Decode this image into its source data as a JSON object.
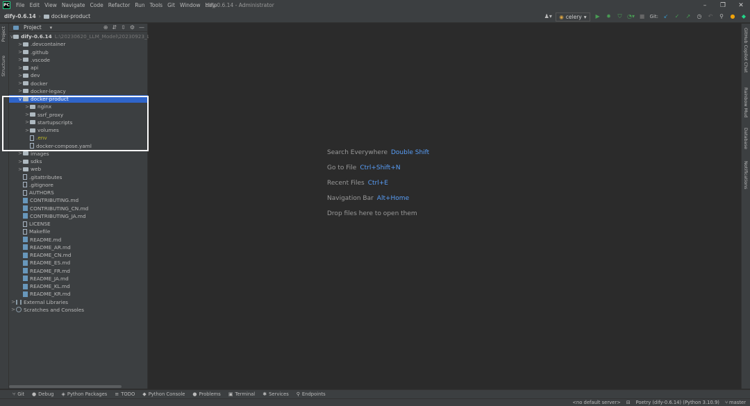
{
  "titlebar": {
    "app_logo": "PC",
    "menu": [
      "File",
      "Edit",
      "View",
      "Navigate",
      "Code",
      "Refactor",
      "Run",
      "Tools",
      "Git",
      "Window",
      "Help"
    ],
    "window_title": "dify-0.6.14 - Administrator",
    "controls": {
      "minimize": "–",
      "restore": "❐",
      "close": "✕"
    }
  },
  "navbar": {
    "project": "dify-0.6.14",
    "folder": "docker-product",
    "run_config": "celery",
    "git_label": "Git:"
  },
  "left_strip": {
    "tabs": [
      "Project",
      "Structure"
    ]
  },
  "right_strip": {
    "tabs": [
      "GitHub Copilot Chat",
      "Rainbow Mud",
      "Database",
      "Notifications"
    ]
  },
  "project_panel": {
    "title": "Project",
    "root": {
      "name": "dify-0.6.14",
      "path": "L:\\20230620_LLM_Model\\20230923_LLMO..."
    },
    "items": [
      {
        "label": ".devcontainer",
        "type": "folder",
        "depth": 1,
        "chevron": ">"
      },
      {
        "label": ".github",
        "type": "folder",
        "depth": 1,
        "chevron": ">"
      },
      {
        "label": ".vscode",
        "type": "folder",
        "depth": 1,
        "chevron": ">"
      },
      {
        "label": "api",
        "type": "folder",
        "depth": 1,
        "chevron": ">"
      },
      {
        "label": "dev",
        "type": "folder",
        "depth": 1,
        "chevron": ">"
      },
      {
        "label": "docker",
        "type": "folder",
        "depth": 1,
        "chevron": ">"
      },
      {
        "label": "docker-legacy",
        "type": "folder",
        "depth": 1,
        "chevron": ">"
      },
      {
        "label": "docker-product",
        "type": "folder",
        "depth": 1,
        "chevron": "v",
        "selected": true
      },
      {
        "label": "nginx",
        "type": "folder",
        "depth": 2,
        "chevron": ">"
      },
      {
        "label": "ssrf_proxy",
        "type": "folder",
        "depth": 2,
        "chevron": ">"
      },
      {
        "label": "startupscripts",
        "type": "folder",
        "depth": 2,
        "chevron": ">"
      },
      {
        "label": "volumes",
        "type": "folder",
        "depth": 2,
        "chevron": ">"
      },
      {
        "label": ".env",
        "type": "env",
        "depth": 2,
        "chevron": ""
      },
      {
        "label": "docker-compose.yaml",
        "type": "file",
        "depth": 2,
        "chevron": ""
      },
      {
        "label": "images",
        "type": "folder",
        "depth": 1,
        "chevron": ">"
      },
      {
        "label": "sdks",
        "type": "folder",
        "depth": 1,
        "chevron": ">"
      },
      {
        "label": "web",
        "type": "folder",
        "depth": 1,
        "chevron": ">"
      },
      {
        "label": ".gitattributes",
        "type": "file",
        "depth": 1,
        "chevron": ""
      },
      {
        "label": ".gitignore",
        "type": "file",
        "depth": 1,
        "chevron": ""
      },
      {
        "label": "AUTHORS",
        "type": "file",
        "depth": 1,
        "chevron": ""
      },
      {
        "label": "CONTRIBUTING.md",
        "type": "md",
        "depth": 1,
        "chevron": ""
      },
      {
        "label": "CONTRIBUTING_CN.md",
        "type": "md",
        "depth": 1,
        "chevron": ""
      },
      {
        "label": "CONTRIBUTING_JA.md",
        "type": "md",
        "depth": 1,
        "chevron": ""
      },
      {
        "label": "LICENSE",
        "type": "file",
        "depth": 1,
        "chevron": ""
      },
      {
        "label": "Makefile",
        "type": "file",
        "depth": 1,
        "chevron": ""
      },
      {
        "label": "README.md",
        "type": "md",
        "depth": 1,
        "chevron": ""
      },
      {
        "label": "README_AR.md",
        "type": "md",
        "depth": 1,
        "chevron": ""
      },
      {
        "label": "README_CN.md",
        "type": "md",
        "depth": 1,
        "chevron": ""
      },
      {
        "label": "README_ES.md",
        "type": "md",
        "depth": 1,
        "chevron": ""
      },
      {
        "label": "README_FR.md",
        "type": "md",
        "depth": 1,
        "chevron": ""
      },
      {
        "label": "README_JA.md",
        "type": "md",
        "depth": 1,
        "chevron": ""
      },
      {
        "label": "README_KL.md",
        "type": "md",
        "depth": 1,
        "chevron": ""
      },
      {
        "label": "README_KR.md",
        "type": "md",
        "depth": 1,
        "chevron": ""
      },
      {
        "label": "External Libraries",
        "type": "lib",
        "depth": 0,
        "chevron": ">"
      },
      {
        "label": "Scratches and Consoles",
        "type": "scratch",
        "depth": 0,
        "chevron": ">"
      }
    ]
  },
  "editor": {
    "hints": [
      {
        "text": "Search Everywhere",
        "key": "Double Shift"
      },
      {
        "text": "Go to File",
        "key": "Ctrl+Shift+N"
      },
      {
        "text": "Recent Files",
        "key": "Ctrl+E"
      },
      {
        "text": "Navigation Bar",
        "key": "Alt+Home"
      },
      {
        "text": "Drop files here to open them",
        "key": ""
      }
    ]
  },
  "bottom_tools": [
    {
      "label": "Git",
      "icon": "⑂"
    },
    {
      "label": "Debug",
      "icon": "●"
    },
    {
      "label": "Python Packages",
      "icon": "◈"
    },
    {
      "label": "TODO",
      "icon": "≡"
    },
    {
      "label": "Python Console",
      "icon": "◆"
    },
    {
      "label": "Problems",
      "icon": "●"
    },
    {
      "label": "Terminal",
      "icon": "▣"
    },
    {
      "label": "Services",
      "icon": "✱"
    },
    {
      "label": "Endpoints",
      "icon": "⚲"
    }
  ],
  "statusbar": {
    "server": "<no default server>",
    "interpreter": "Poetry (dify-0.6.14) (Python 3.10.9)",
    "branch": "master"
  }
}
